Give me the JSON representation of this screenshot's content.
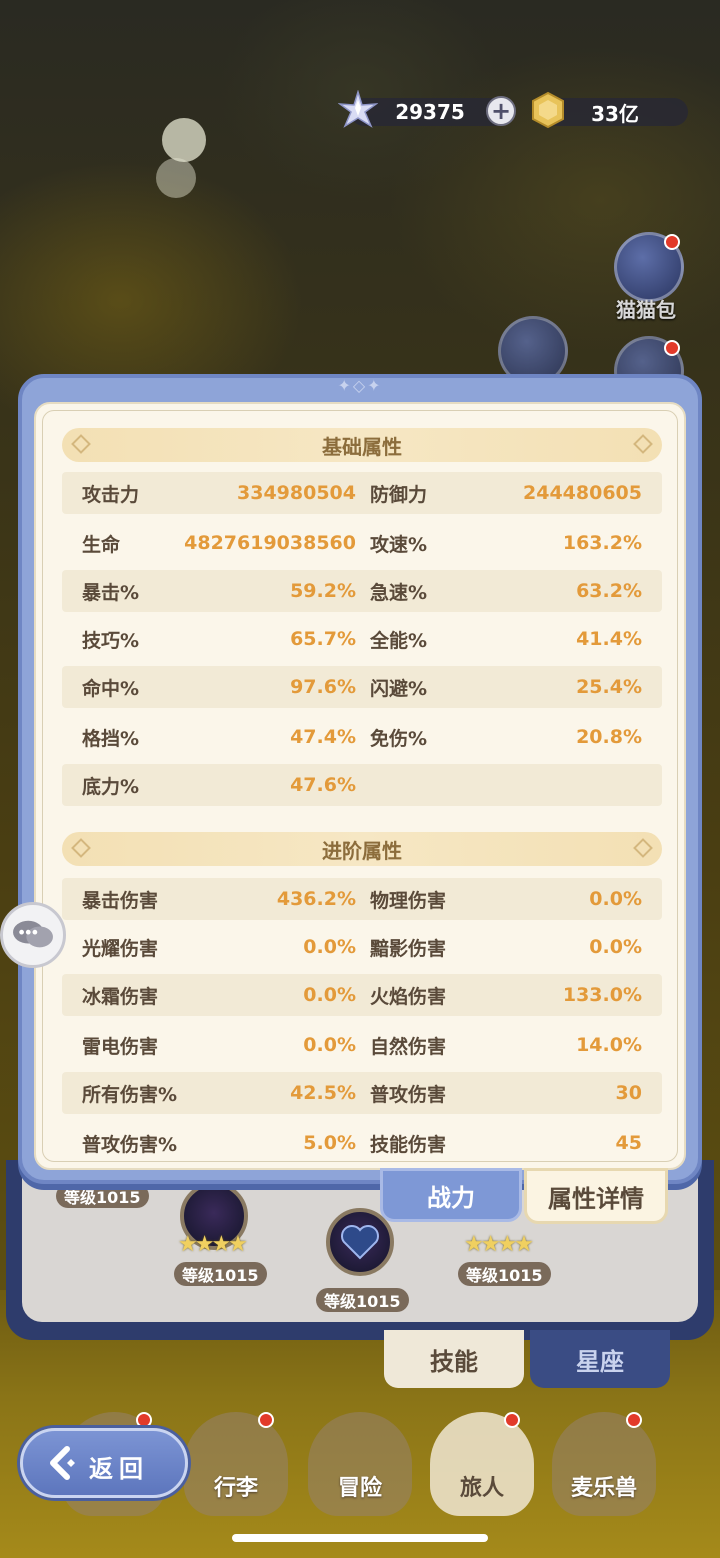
{
  "currency": {
    "crystals": "29375",
    "coins": "33亿"
  },
  "side_buttons": {
    "cat_bag_label": "猫猫包"
  },
  "basic_section": {
    "title": "基础属性",
    "rows": [
      [
        {
          "k": "攻击力",
          "v": "334980504"
        },
        {
          "k": "防御力",
          "v": "244480605"
        }
      ],
      [
        {
          "k": "生命",
          "v": "4827619038560"
        },
        {
          "k": "攻速%",
          "v": "163.2%"
        }
      ],
      [
        {
          "k": "暴击%",
          "v": "59.2%"
        },
        {
          "k": "急速%",
          "v": "63.2%"
        }
      ],
      [
        {
          "k": "技巧%",
          "v": "65.7%"
        },
        {
          "k": "全能%",
          "v": "41.4%"
        }
      ],
      [
        {
          "k": "命中%",
          "v": "97.6%"
        },
        {
          "k": "闪避%",
          "v": "25.4%"
        }
      ],
      [
        {
          "k": "格挡%",
          "v": "47.4%"
        },
        {
          "k": "免伤%",
          "v": "20.8%"
        }
      ],
      [
        {
          "k": "底力%",
          "v": "47.6%"
        },
        {
          "k": "",
          "v": ""
        }
      ]
    ]
  },
  "advanced_section": {
    "title": "进阶属性",
    "rows": [
      [
        {
          "k": "暴击伤害",
          "v": "436.2%"
        },
        {
          "k": "物理伤害",
          "v": "0.0%"
        }
      ],
      [
        {
          "k": "光耀伤害",
          "v": "0.0%"
        },
        {
          "k": "黯影伤害",
          "v": "0.0%"
        }
      ],
      [
        {
          "k": "冰霜伤害",
          "v": "0.0%"
        },
        {
          "k": "火焰伤害",
          "v": "133.0%"
        }
      ],
      [
        {
          "k": "雷电伤害",
          "v": "0.0%"
        },
        {
          "k": "自然伤害",
          "v": "14.0%"
        }
      ],
      [
        {
          "k": "所有伤害%",
          "v": "42.5%"
        },
        {
          "k": "普攻伤害",
          "v": "30"
        }
      ],
      [
        {
          "k": "普攻伤害%",
          "v": "5.0%"
        },
        {
          "k": "技能伤害",
          "v": "45"
        }
      ]
    ]
  },
  "panel_tabs": {
    "power": "战力",
    "details": "属性详情"
  },
  "level_badges": [
    "等级1015",
    "等级1015",
    "等级1015",
    "等级1015"
  ],
  "lower_tabs": {
    "skills": "技能",
    "constellation": "星座"
  },
  "bottom_nav": {
    "back": "返回",
    "items": [
      "行李",
      "冒险",
      "旅人",
      "麦乐兽"
    ]
  },
  "colors": {
    "panel_blue": "#8ea4d8",
    "panel_cream": "#fbf6ea",
    "value_orange": "#e39a3a",
    "label_brown": "#5a4a3a"
  }
}
